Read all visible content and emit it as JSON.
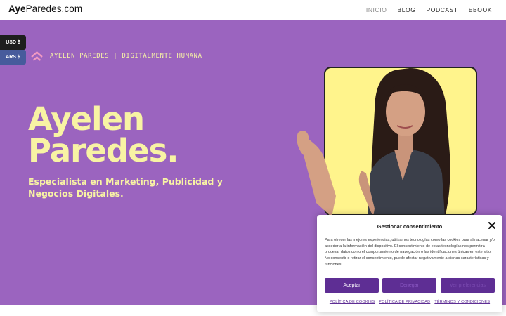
{
  "header": {
    "logo_bold": "Aye",
    "logo_rest": "Paredes.com",
    "nav": [
      {
        "label": "INICIO"
      },
      {
        "label": "BLOG"
      },
      {
        "label": "PODCAST"
      },
      {
        "label": "EBOOK"
      }
    ]
  },
  "currency": {
    "usd": "USD $",
    "ars": "ARS $"
  },
  "hero": {
    "tagline": "AYELEN PAREDES | DIGITALMENTE HUMANA",
    "title_line1": "Ayelen",
    "title_line2": "Paredes.",
    "subtitle": "Especialista en Marketing, Publicidad y Negocios Digitales."
  },
  "cookie": {
    "title": "Gestionar consentimiento",
    "body": "Para ofrecer las mejores experiencias, utilizamos tecnologías como las cookies para almacenar y/o acceder a la información del dispositivo. El consentimiento de estas tecnologías nos permitirá procesar datos como el comportamiento de navegación o las identificaciones únicas en este sitio. No consentir o retirar el consentimiento, puede afectar negativamente a ciertas características y funciones.",
    "accept": "Aceptar",
    "deny": "Denegar",
    "preferences": "Ver preferencias",
    "links": [
      {
        "label": "POLÍTICA DE COOKIES"
      },
      {
        "label": "POLÍTICA DE PRIVACIDAD"
      },
      {
        "label": "TÉRMINOS Y CONDICIONES"
      }
    ]
  },
  "colors": {
    "hero_bg": "#9b64bf",
    "accent_yellow": "#f8f3a4",
    "button_purple": "#5e2e94"
  }
}
